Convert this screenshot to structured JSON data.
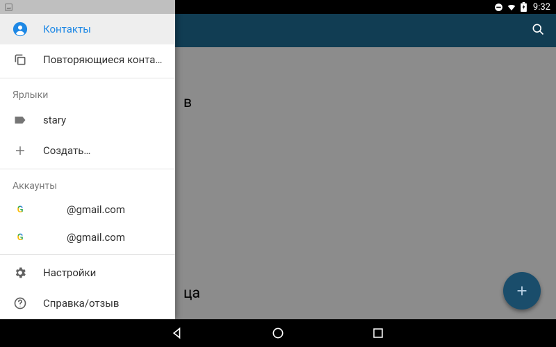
{
  "statusbar": {
    "time": "9:32"
  },
  "main": {
    "fragment1": "в",
    "fragment2": "ца"
  },
  "drawer": {
    "items": {
      "contacts": "Контакты",
      "duplicates": "Повторяющиеся конта…"
    },
    "sections": {
      "labels": "Ярлыки",
      "accounts": "Аккаунты"
    },
    "labels": [
      {
        "name": "stary"
      }
    ],
    "create_label": "Создать…",
    "accounts": [
      {
        "email": "@gmail.com"
      },
      {
        "email": "@gmail.com"
      }
    ],
    "settings": "Настройки",
    "feedback": "Справка/отзыв"
  }
}
